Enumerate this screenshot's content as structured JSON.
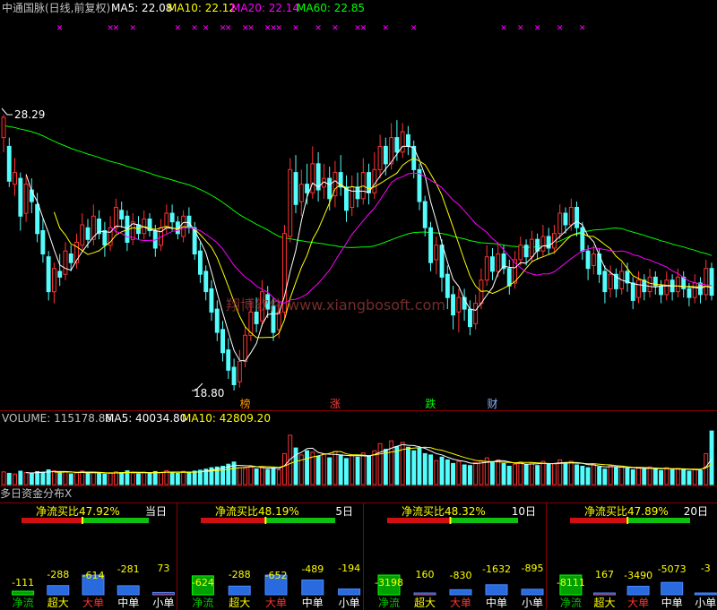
{
  "header": {
    "title": "中通国脉(日线,前复权)",
    "ma5": "MA5: 22.08",
    "ma10": "MA10: 22.12",
    "ma20": "MA20: 22.14",
    "ma60": "MA60: 22.85"
  },
  "colors": {
    "up": "#ff3232",
    "down": "#54fcfc",
    "ma5": "#ffffff",
    "ma10": "#ffff00",
    "ma20": "#ff00ff",
    "ma60": "#00ff00",
    "panel_line": "#8b0000"
  },
  "price": {
    "high_label": "28.29",
    "low_label": "18.80",
    "watermark": "翔博软件 www.xiangbosoft.com",
    "markers": [
      {
        "label": "榜",
        "color": "#ff9900",
        "bar": 43
      },
      {
        "label": "涨",
        "color": "#ff4040",
        "bar": 59
      },
      {
        "label": "跌",
        "color": "#00ff00",
        "bar": 76
      },
      {
        "label": "财",
        "color": "#8ab4ff",
        "bar": 87
      }
    ],
    "signal_glyph": "✕"
  },
  "volume": {
    "label": "VOLUME: 115178.86",
    "ma5": "MA5: 40034.80",
    "ma10": "MA10: 42809.20"
  },
  "fund": {
    "title": "多日资金分布X",
    "panels": [
      {
        "period": "当日",
        "ratio": "净流买比47.92%",
        "ratio_pct": 47.92,
        "values": [
          "-111",
          "-288",
          "-614",
          "-281",
          "73"
        ],
        "bars": [
          -111,
          -288,
          -614,
          -281,
          73
        ],
        "labels": [
          "净流",
          "超大",
          "大单",
          "中单",
          "小单"
        ]
      },
      {
        "period": "5日",
        "ratio": "净流买比48.19%",
        "ratio_pct": 48.19,
        "values": [
          "-624",
          "-288",
          "-652",
          "-489",
          "-194"
        ],
        "bars": [
          -624,
          -288,
          -652,
          -489,
          -194
        ],
        "labels": [
          "净流",
          "超大",
          "大单",
          "中单",
          "小单"
        ]
      },
      {
        "period": "10日",
        "ratio": "净流买比48.32%",
        "ratio_pct": 48.32,
        "values": [
          "-3198",
          "160",
          "-830",
          "-1632",
          "-895"
        ],
        "bars": [
          -3198,
          160,
          -830,
          -1632,
          -895
        ],
        "labels": [
          "净流",
          "超大",
          "大单",
          "中单",
          "小单"
        ]
      },
      {
        "period": "20日",
        "ratio": "净流买比47.89%",
        "ratio_pct": 47.89,
        "values": [
          "-8111",
          "167",
          "-3490",
          "-5073",
          "-3"
        ],
        "bars": [
          -8111,
          167,
          -3490,
          -5073,
          -3
        ],
        "labels": [
          "净流",
          "超大",
          "大单",
          "中单",
          "小单"
        ]
      }
    ]
  },
  "chart_data": {
    "type": "candlestick",
    "ylim": [
      18.8,
      28.29
    ],
    "ma_periods": [
      5,
      10,
      20,
      60
    ],
    "signal_bars": [
      10,
      19,
      20,
      23,
      31,
      34,
      36,
      39,
      40,
      43,
      44,
      47,
      48,
      49,
      52,
      56,
      59,
      63,
      64,
      68,
      73,
      89,
      92,
      95,
      99,
      103
    ],
    "candles": [
      [
        27.5,
        28.2,
        28.29,
        27.0
      ],
      [
        27.2,
        26.0,
        27.5,
        25.8
      ],
      [
        25.9,
        26.3,
        26.8,
        25.5
      ],
      [
        26.1,
        24.8,
        26.3,
        24.3
      ],
      [
        24.9,
        25.9,
        26.2,
        24.6
      ],
      [
        25.7,
        25.3,
        26.1,
        24.9
      ],
      [
        25.2,
        24.2,
        25.6,
        23.9
      ],
      [
        24.3,
        23.5,
        24.7,
        23.2
      ],
      [
        23.4,
        22.2,
        23.6,
        21.9
      ],
      [
        22.2,
        23.0,
        23.2,
        21.8
      ],
      [
        22.9,
        22.7,
        23.5,
        22.4
      ],
      [
        22.8,
        23.6,
        23.9,
        22.6
      ],
      [
        23.5,
        23.2,
        23.8,
        22.9
      ],
      [
        23.2,
        23.9,
        24.2,
        23.0
      ],
      [
        23.8,
        24.5,
        24.9,
        23.6
      ],
      [
        24.4,
        24.0,
        24.7,
        23.7
      ],
      [
        24.0,
        24.8,
        25.2,
        23.8
      ],
      [
        24.7,
        24.2,
        25.0,
        24.0
      ],
      [
        24.3,
        23.8,
        24.6,
        23.4
      ],
      [
        23.8,
        24.4,
        24.8,
        23.6
      ],
      [
        24.4,
        25.1,
        25.4,
        24.2
      ],
      [
        25.0,
        24.7,
        25.3,
        24.4
      ],
      [
        24.8,
        23.9,
        25.0,
        23.6
      ],
      [
        24.0,
        24.6,
        24.9,
        23.8
      ],
      [
        24.5,
        24.2,
        24.8,
        24.0
      ],
      [
        24.2,
        24.7,
        25.0,
        24.0
      ],
      [
        24.7,
        24.3,
        24.9,
        24.1
      ],
      [
        24.3,
        23.7,
        24.5,
        23.4
      ],
      [
        23.8,
        24.4,
        24.7,
        23.6
      ],
      [
        24.4,
        24.9,
        25.2,
        24.2
      ],
      [
        24.9,
        24.6,
        25.2,
        24.3
      ],
      [
        24.6,
        24.2,
        24.8,
        24.0
      ],
      [
        24.1,
        24.8,
        25.0,
        23.9
      ],
      [
        24.8,
        24.4,
        25.1,
        24.2
      ],
      [
        24.4,
        23.5,
        24.6,
        23.3
      ],
      [
        23.6,
        22.8,
        23.9,
        22.5
      ],
      [
        22.9,
        22.2,
        23.1,
        21.9
      ],
      [
        22.3,
        21.5,
        22.6,
        21.2
      ],
      [
        21.6,
        20.8,
        21.9,
        20.5
      ],
      [
        20.9,
        20.1,
        21.2,
        19.8
      ],
      [
        20.2,
        19.5,
        20.6,
        19.2
      ],
      [
        19.6,
        19.0,
        19.9,
        18.8
      ],
      [
        19.1,
        19.8,
        20.2,
        18.9
      ],
      [
        19.8,
        20.7,
        21.0,
        19.6
      ],
      [
        20.7,
        21.5,
        21.9,
        20.5
      ],
      [
        21.5,
        21.1,
        22.0,
        20.8
      ],
      [
        21.2,
        22.2,
        22.6,
        21.0
      ],
      [
        22.1,
        21.6,
        22.4,
        21.3
      ],
      [
        21.7,
        20.8,
        22.0,
        20.5
      ],
      [
        20.9,
        21.5,
        21.9,
        20.6
      ],
      [
        21.5,
        24.2,
        24.5,
        21.3
      ],
      [
        24.1,
        26.4,
        26.8,
        23.9
      ],
      [
        26.3,
        25.2,
        26.9,
        24.9
      ],
      [
        25.3,
        25.9,
        26.4,
        24.8
      ],
      [
        25.9,
        25.6,
        26.6,
        25.2
      ],
      [
        25.6,
        26.6,
        27.2,
        25.4
      ],
      [
        26.6,
        25.7,
        27.0,
        25.3
      ],
      [
        25.8,
        26.1,
        26.6,
        25.4
      ],
      [
        26.1,
        25.4,
        26.5,
        25.0
      ],
      [
        25.5,
        26.3,
        26.7,
        25.1
      ],
      [
        26.3,
        25.8,
        26.9,
        25.5
      ],
      [
        25.8,
        25.0,
        26.2,
        24.6
      ],
      [
        25.1,
        25.8,
        26.2,
        24.8
      ],
      [
        25.8,
        25.4,
        26.3,
        25.1
      ],
      [
        25.4,
        26.3,
        26.8,
        25.2
      ],
      [
        26.3,
        25.6,
        26.6,
        25.2
      ],
      [
        25.6,
        26.4,
        27.0,
        25.4
      ],
      [
        26.4,
        27.2,
        27.6,
        26.1
      ],
      [
        27.2,
        26.6,
        27.5,
        26.2
      ],
      [
        26.6,
        27.5,
        28.0,
        26.4
      ],
      [
        27.5,
        27.0,
        28.1,
        26.7
      ],
      [
        27.0,
        27.7,
        28.0,
        26.8
      ],
      [
        27.6,
        27.2,
        27.9,
        26.9
      ],
      [
        27.2,
        26.4,
        27.4,
        26.1
      ],
      [
        26.4,
        25.3,
        26.6,
        25.0
      ],
      [
        25.3,
        24.4,
        25.5,
        24.1
      ],
      [
        24.4,
        23.2,
        24.6,
        22.9
      ],
      [
        23.3,
        23.8,
        24.1,
        22.8
      ],
      [
        23.8,
        22.7,
        24.0,
        22.2
      ],
      [
        22.8,
        22.0,
        23.1,
        21.6
      ],
      [
        22.1,
        21.4,
        22.4,
        20.9
      ],
      [
        21.5,
        22.0,
        22.3,
        20.8
      ],
      [
        22.0,
        21.6,
        22.3,
        21.2
      ],
      [
        21.6,
        21.0,
        21.9,
        20.7
      ],
      [
        21.1,
        21.8,
        22.1,
        20.9
      ],
      [
        21.8,
        22.6,
        23.0,
        21.6
      ],
      [
        22.6,
        23.4,
        23.8,
        22.4
      ],
      [
        23.4,
        22.9,
        23.7,
        22.6
      ],
      [
        22.9,
        23.5,
        23.9,
        22.7
      ],
      [
        23.5,
        23.0,
        23.8,
        22.8
      ],
      [
        23.0,
        22.4,
        23.3,
        22.1
      ],
      [
        22.5,
        23.3,
        23.6,
        22.3
      ],
      [
        23.3,
        23.8,
        24.1,
        23.1
      ],
      [
        23.8,
        23.4,
        24.0,
        23.1
      ],
      [
        23.4,
        24.0,
        24.3,
        23.2
      ],
      [
        24.0,
        23.6,
        24.2,
        23.3
      ],
      [
        23.6,
        24.1,
        24.5,
        23.4
      ],
      [
        24.1,
        23.7,
        24.4,
        23.5
      ],
      [
        23.7,
        24.2,
        24.5,
        23.5
      ],
      [
        24.2,
        24.9,
        25.2,
        24.0
      ],
      [
        24.9,
        24.5,
        25.1,
        24.2
      ],
      [
        24.5,
        25.1,
        25.4,
        24.3
      ],
      [
        25.1,
        24.4,
        25.3,
        24.1
      ],
      [
        24.4,
        23.6,
        24.6,
        23.3
      ],
      [
        23.6,
        23.0,
        23.8,
        22.6
      ],
      [
        23.1,
        23.5,
        23.8,
        22.8
      ],
      [
        23.5,
        22.8,
        23.7,
        22.5
      ],
      [
        22.9,
        22.2,
        23.1,
        21.8
      ],
      [
        22.3,
        22.8,
        23.1,
        22.0
      ],
      [
        22.8,
        22.3,
        23.0,
        22.0
      ],
      [
        22.3,
        22.9,
        23.2,
        22.1
      ],
      [
        22.9,
        22.5,
        23.2,
        22.2
      ],
      [
        22.5,
        21.9,
        22.7,
        21.6
      ],
      [
        22.0,
        22.6,
        22.9,
        21.8
      ],
      [
        22.6,
        22.2,
        22.8,
        21.9
      ],
      [
        22.2,
        22.7,
        23.0,
        22.0
      ],
      [
        22.7,
        22.4,
        22.9,
        22.1
      ],
      [
        22.4,
        22.1,
        22.6,
        21.8
      ],
      [
        22.1,
        22.6,
        22.9,
        21.9
      ],
      [
        22.6,
        22.2,
        22.8,
        21.9
      ],
      [
        22.2,
        22.7,
        23.0,
        22.0
      ],
      [
        22.7,
        22.3,
        22.9,
        22.0
      ],
      [
        22.3,
        22.0,
        22.5,
        21.7
      ],
      [
        22.0,
        22.5,
        22.8,
        21.8
      ],
      [
        22.5,
        22.1,
        22.7,
        21.8
      ],
      [
        22.1,
        23.0,
        23.3,
        21.9
      ],
      [
        23.0,
        22.08,
        23.2,
        21.9
      ]
    ],
    "volume": [
      9000,
      8000,
      7500,
      9500,
      8500,
      7800,
      9200,
      8800,
      10500,
      9800,
      8200,
      9000,
      7600,
      8400,
      9600,
      8000,
      8700,
      7900,
      7400,
      8300,
      9100,
      8600,
      9800,
      8200,
      7700,
      8800,
      8100,
      9300,
      8500,
      9900,
      8700,
      8000,
      9400,
      8300,
      9600,
      10200,
      11000,
      12000,
      12500,
      13000,
      14500,
      16000,
      12000,
      11500,
      12800,
      11200,
      12500,
      10800,
      11600,
      10400,
      22000,
      35000,
      26000,
      21000,
      24000,
      23000,
      20000,
      21500,
      19000,
      23500,
      21000,
      18500,
      20500,
      19500,
      22500,
      20000,
      24000,
      29000,
      25000,
      31000,
      27000,
      30000,
      26500,
      24000,
      26000,
      22000,
      21000,
      17000,
      19500,
      17500,
      15000,
      16500,
      14000,
      13500,
      15500,
      17000,
      19000,
      16000,
      17500,
      15000,
      13000,
      14500,
      16000,
      14000,
      15500,
      13500,
      16500,
      14500,
      15000,
      17500,
      15000,
      16500,
      14000,
      13000,
      12000,
      14500,
      12500,
      11000,
      13500,
      12000,
      12500,
      11500,
      10500,
      12000,
      11000,
      12500,
      11000,
      10000,
      12000,
      10500,
      11500,
      10500,
      9500,
      11000,
      10000,
      22000,
      38000
    ],
    "volume_max": 40000
  }
}
